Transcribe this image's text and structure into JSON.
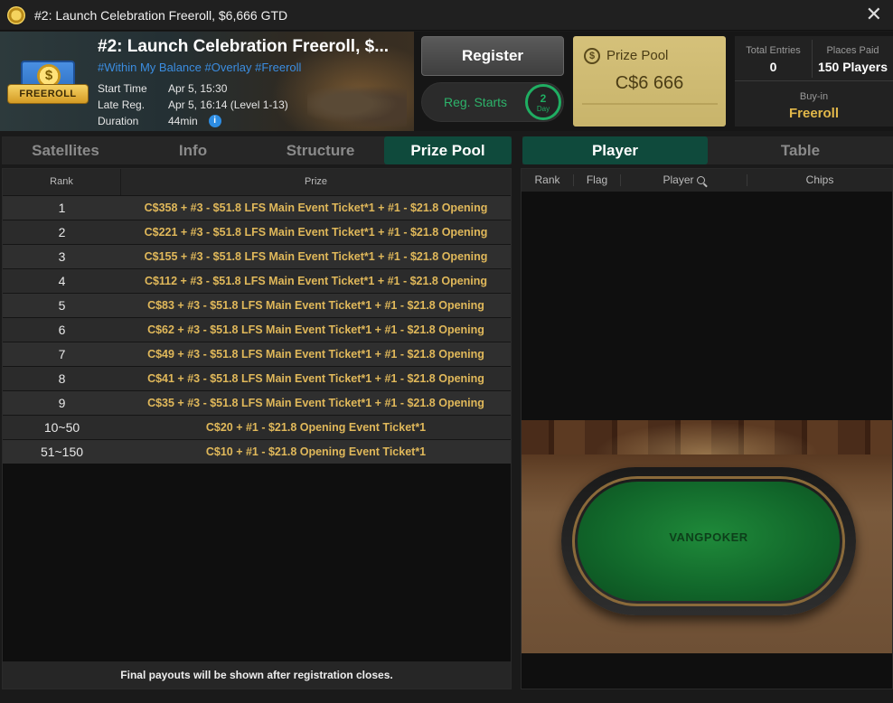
{
  "window": {
    "title": "#2: Launch Celebration Freeroll, $6,666 GTD",
    "close_glyph": "✕"
  },
  "tournament": {
    "badge_label": "FREEROLL",
    "name": "#2: Launch Celebration Freeroll, $...",
    "tags": "#Within My Balance #Overlay #Freeroll",
    "start_label": "Start Time",
    "start_value": "Apr 5, 15:30",
    "late_label": "Late Reg.",
    "late_value": "Apr 5, 16:14 (Level 1-13)",
    "duration_label": "Duration",
    "duration_value": "44min"
  },
  "actions": {
    "register_label": "Register",
    "reg_starts_label": "Reg. Starts",
    "reg_starts_count": "2",
    "reg_starts_unit": "Day"
  },
  "prize_pool": {
    "label": "Prize Pool",
    "value": "C$6 666"
  },
  "stats": {
    "entries_label": "Total Entries",
    "entries_value": "0",
    "paid_label": "Places Paid",
    "paid_value": "150 Players",
    "buyin_label": "Buy-in",
    "buyin_value": "Freeroll"
  },
  "left_tabs": [
    "Satellites",
    "Info",
    "Structure",
    "Prize Pool"
  ],
  "right_tabs": [
    "Player",
    "Table"
  ],
  "prize_table": {
    "col_rank": "Rank",
    "col_prize": "Prize",
    "rows": [
      {
        "rank": "1",
        "prize": "C$358 + #3 - $51.8 LFS Main Event Ticket*1  + #1 - $21.8 Opening"
      },
      {
        "rank": "2",
        "prize": "C$221 + #3 - $51.8 LFS Main Event Ticket*1  + #1 - $21.8 Opening"
      },
      {
        "rank": "3",
        "prize": "C$155 + #3 - $51.8 LFS Main Event Ticket*1  + #1 - $21.8 Opening"
      },
      {
        "rank": "4",
        "prize": "C$112 + #3 - $51.8 LFS Main Event Ticket*1  + #1 - $21.8 Opening"
      },
      {
        "rank": "5",
        "prize": "C$83 + #3 - $51.8 LFS Main Event Ticket*1  + #1 - $21.8 Opening"
      },
      {
        "rank": "6",
        "prize": "C$62 + #3 - $51.8 LFS Main Event Ticket*1  + #1 - $21.8 Opening"
      },
      {
        "rank": "7",
        "prize": "C$49 + #3 - $51.8 LFS Main Event Ticket*1  + #1 - $21.8 Opening"
      },
      {
        "rank": "8",
        "prize": "C$41 + #3 - $51.8 LFS Main Event Ticket*1  + #1 - $21.8 Opening"
      },
      {
        "rank": "9",
        "prize": "C$35 + #3 - $51.8 LFS Main Event Ticket*1  + #1 - $21.8 Opening"
      },
      {
        "rank": "10~50",
        "prize": "C$20 + #1 - $21.8 Opening Event Ticket*1"
      },
      {
        "rank": "51~150",
        "prize": "C$10 + #1 - $21.8 Opening Event Ticket*1"
      }
    ],
    "footnote": "Final payouts will be shown after registration closes."
  },
  "player_table": {
    "col_rank": "Rank",
    "col_flag": "Flag",
    "col_player": "Player",
    "col_chips": "Chips"
  },
  "table_logo": "VANGPOKER",
  "colors": {
    "active_tab": "#0f4a3c",
    "prize_gold": "#e0b85a",
    "tag_blue": "#3b8de0",
    "reg_green": "#1fae62",
    "prize_box": "#d5c17a"
  }
}
